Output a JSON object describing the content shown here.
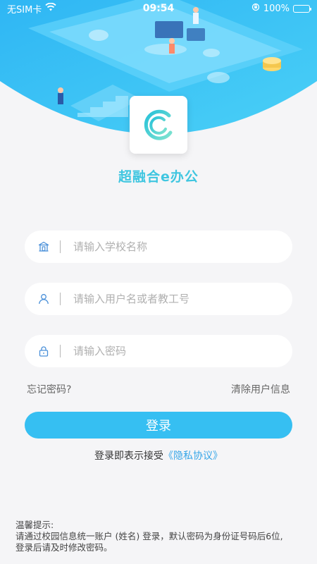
{
  "status_bar": {
    "carrier": "无SIM卡",
    "time": "09:54",
    "battery": "100%"
  },
  "app": {
    "name": "超融合e办公"
  },
  "form": {
    "school_placeholder": "请输入学校名称",
    "username_placeholder": "请输入用户名或者教工号",
    "password_placeholder": "请输入密码"
  },
  "links": {
    "forgot_password": "忘记密码?",
    "clear_user_info": "清除用户信息"
  },
  "login_button": "登录",
  "agreement": {
    "prefix": "登录即表示接受",
    "privacy_link": "《隐私协议》"
  },
  "notice": {
    "title": "温馨提示:",
    "line1": "请通过校园信息统一账户 (姓名) 登录，默认密码为身份证号码后6位,",
    "line2": "登录后请及时修改密码。"
  },
  "colors": {
    "accent": "#36bff2",
    "app_name": "#3fc6e0",
    "privacy_link": "#36a6e8"
  }
}
